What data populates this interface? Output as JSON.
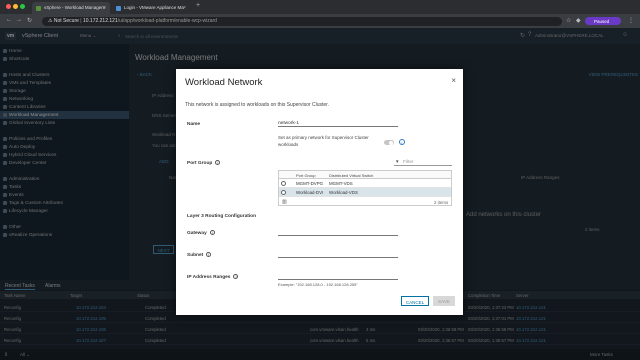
{
  "browser": {
    "tabs": [
      {
        "label": "vSphere - Workload Managem",
        "color": "#5a8f3a"
      },
      {
        "label": "Login - VMware Appliance Ma",
        "color": "#4a90d9"
      }
    ],
    "new_tab": "+",
    "not_secure": "Not Secure",
    "url_host": "10.172.212.121",
    "url_path": "/ui/app/workload-platform/enable-wcp-wizard",
    "paused_label": "Paused"
  },
  "app": {
    "logo": "vm",
    "title": "vSphere Client",
    "menu": "Menu",
    "search_placeholder": "Search in all environments",
    "user": "Administrator@VSPHERE.LOCAL"
  },
  "sidebar": {
    "items": [
      {
        "label": "Home",
        "active": false
      },
      {
        "label": "Shortcuts",
        "active": false
      },
      {
        "label": "Hosts and Clusters",
        "active": false
      },
      {
        "label": "VMs and Templates",
        "active": false
      },
      {
        "label": "Storage",
        "active": false
      },
      {
        "label": "Networking",
        "active": false
      },
      {
        "label": "Content Libraries",
        "active": false
      },
      {
        "label": "Workload Management",
        "active": true
      },
      {
        "label": "Global Inventory Lists",
        "active": false
      },
      {
        "label": "Policies and Profiles",
        "active": false
      },
      {
        "label": "Auto Deploy",
        "active": false
      },
      {
        "label": "Hybrid Cloud Services",
        "active": false
      },
      {
        "label": "Developer Center",
        "active": false
      },
      {
        "label": "Administration",
        "active": false
      },
      {
        "label": "Tasks",
        "active": false
      },
      {
        "label": "Events",
        "active": false
      },
      {
        "label": "Tags & Custom Attributes",
        "active": false
      },
      {
        "label": "Lifecycle Manager",
        "active": false
      },
      {
        "label": "Other",
        "active": false
      },
      {
        "label": "vRealize Operations",
        "active": false
      }
    ]
  },
  "main": {
    "title": "Workload Management",
    "back": "BACK",
    "view_prereqs": "VIEW PREREQUISITES",
    "fragments": [
      "IP Address",
      "DNS Server",
      "Workload N",
      "You can add",
      "ADD",
      "Name",
      "IP Address Ranges",
      "Add networks on this cluster",
      "0 items"
    ],
    "next": "NEXT"
  },
  "bottom": {
    "tabs": [
      "Recent Tasks",
      "Alarms"
    ],
    "columns": [
      "Task Name",
      "Target",
      "Status",
      "Details",
      "Initiator",
      "Queued For",
      "Start Time",
      "Completion Time",
      "Server"
    ],
    "rows": [
      {
        "task": "Reconfig",
        "target": "10.172.212.104",
        "status": "Completed",
        "initiator": "",
        "queued": "",
        "start": "",
        "completion": "03/20/2020, 1:37:23 PM",
        "server": "10.172.212.121"
      },
      {
        "task": "Reconfig",
        "target": "10.172.212.105",
        "status": "Completed",
        "initiator": "",
        "queued": "",
        "start": "",
        "completion": "03/20/2020, 1:37:01 PM",
        "server": "10.172.212.121"
      },
      {
        "task": "Reconfig",
        "target": "10.172.212.106",
        "status": "Completed",
        "initiator": "com.vmware.vlsan.health",
        "queued": "4 ms",
        "start": "03/20/2020, 1:36:58 PM",
        "completion": "03/20/2020, 1:36:58 PM",
        "server": "10.172.212.121"
      },
      {
        "task": "Reconfig",
        "target": "10.172.212.107",
        "status": "Completed",
        "initiator": "com.vmware.vlsan.health",
        "queued": "5 ms",
        "start": "03/20/2020, 1:36:57 PM",
        "completion": "03/20/2020, 1:36:57 PM",
        "server": "10.172.212.121"
      },
      {
        "task": "Reconfig",
        "target": "10.172.212.108",
        "status": "Completed",
        "initiator": "com.vmware.vlsan.health",
        "queued": "5 ms",
        "start": "03/20/2020, 1:36:57 PM",
        "completion": "03/20/2020, 1:36:57 PM",
        "server": "10.172.212.121"
      }
    ],
    "footer_all": "All",
    "footer_more": "More Tasks"
  },
  "modal": {
    "title": "Workload Network",
    "close": "×",
    "description": "This network is assigned to workloads on this Supervisor Cluster.",
    "name_label": "Name",
    "name_value": "network-1",
    "primary_text": "Set as primary network for Supervisor Cluster workloads",
    "port_group_label": "Port Group",
    "filter_placeholder": "Filter",
    "grid_columns": [
      "Port Group",
      "Distributed Virtual Switch"
    ],
    "grid_rows": [
      {
        "port_group": "MGMT-DVPG",
        "switch": "MGMT-VDS",
        "selected": false
      },
      {
        "port_group": "Workload-DVI",
        "switch": "Workload-VDS",
        "selected": true
      }
    ],
    "grid_count": "2 items",
    "l3_label": "Layer 3 Routing Configuration",
    "gateway_label": "Gateway",
    "subnet_label": "Subnet",
    "ip_ranges_label": "IP Address Ranges",
    "ip_example": "Example: \"192.168.128.0 - 192.168.128.255\"",
    "cancel": "CANCEL",
    "save": "SAVE"
  },
  "colors": {
    "accent": "#0072a3",
    "link": "#57a6d9",
    "header": "#2a3947"
  }
}
